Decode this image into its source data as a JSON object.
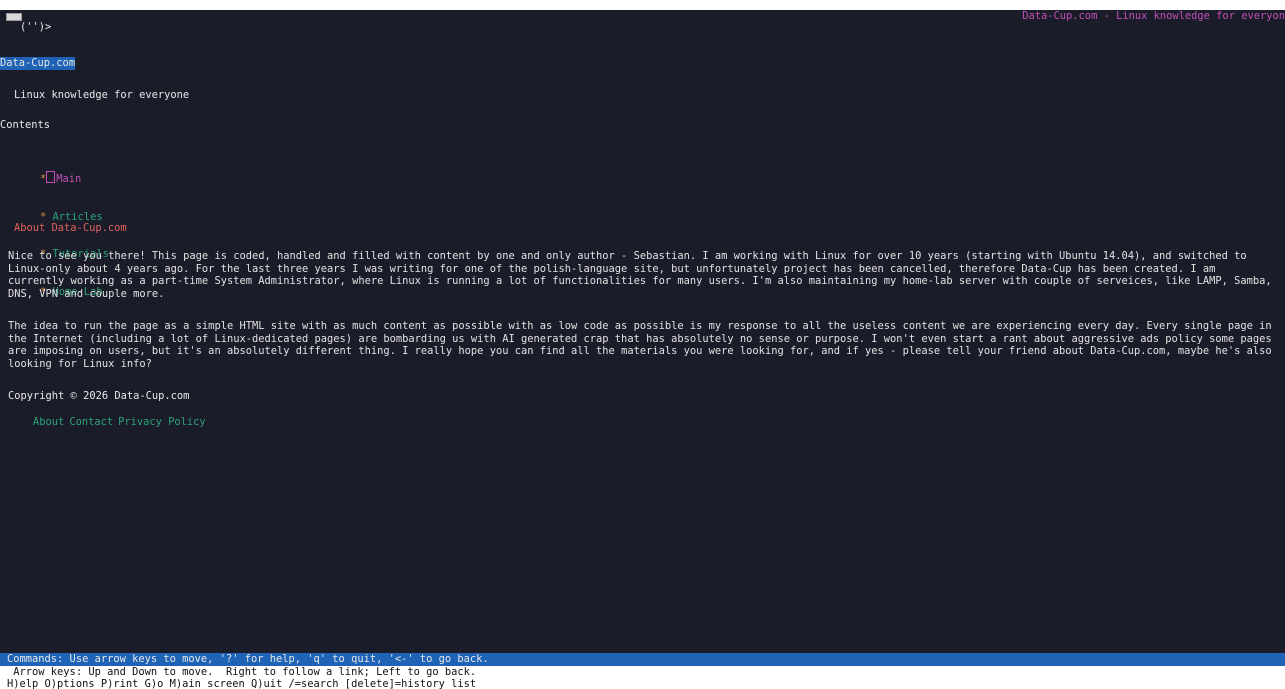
{
  "window": {
    "logo_glyph": "('')>",
    "top_right_title": "Data-Cup.com - Linux knowledge for everyon"
  },
  "site": {
    "header_link": "Data-Cup.com",
    "tagline": "Linux knowledge for everyone"
  },
  "contents": {
    "heading": "Contents",
    "bullet": "*",
    "items": [
      {
        "label": "Main"
      },
      {
        "label": "Articles"
      },
      {
        "label": "Tutorials"
      },
      {
        "label": "Home-Lab"
      }
    ]
  },
  "about": {
    "heading": "About Data-Cup.com",
    "paragraph1": "Nice to see you there! This page is coded, handled and filled with content by one and only author - Sebastian. I am working with Linux for over 10 years (starting with Ubuntu 14.04), and switched to Linux-only about 4 years ago. For the last three years I was writing for one of the polish-language site, but unfortunately project has been cancelled, therefore Data-Cup has been created. I am currently working as a part-time System Administrator, where Linux is running a lot of functionalities for many users. I'm also maintaining my home-lab server with couple of serveices, like LAMP, Samba, DNS, VPN and couple more.",
    "paragraph2": "The idea to run the page as a simple HTML site with as much content as possible with as low code as possible is my response to all the useless content we are experiencing every day. Every single page in the Internet (including a lot of Linux-dedicated pages) are bombarding us with AI generated crap that has absolutely no sense or purpose. I won't even start a rant about aggressive ads policy some pages are imposing on users, but it's an absolutely different thing. I really hope you can find all the materials you were looking for, and if yes - please tell your friend about Data-Cup.com, maybe he's also looking for Linux info?"
  },
  "footer": {
    "copyright": "Copyright © 2026 Data-Cup.com",
    "links": [
      {
        "label": "About"
      },
      {
        "label": "Contact"
      },
      {
        "label": "Privacy Policy"
      }
    ]
  },
  "statusbar": {
    "commands": "Commands: Use arrow keys to move, '?' for help, 'q' to quit, '<-' to go back.",
    "help1": " Arrow keys: Up and Down to move.  Right to follow a link; Left to go back.",
    "help2": "H)elp O)ptions P)rint G)o M)ain screen Q)uit /=search [delete]=history list"
  },
  "colors": {
    "background": "#1b1c2a",
    "highlight": "#1f63b6",
    "heading_red": "#e0625a",
    "link_green": "#2aa376",
    "title_pink": "#c24fb5"
  }
}
